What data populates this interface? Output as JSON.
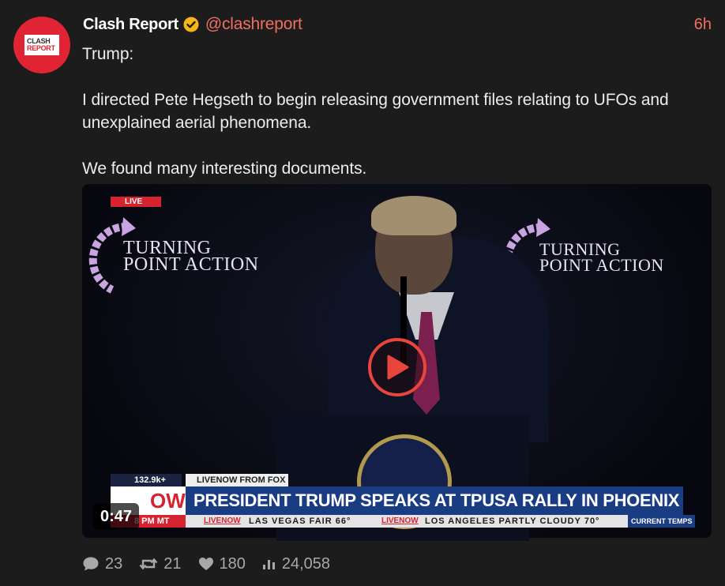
{
  "post": {
    "display_name": "Clash Report",
    "handle": "@clashreport",
    "time": "6h",
    "avatar": {
      "line1": "CLASH",
      "line2": "REPORT",
      "color": "#e02434"
    },
    "verified_icon": "verified-check-icon",
    "text_lines": [
      "Trump:",
      "I directed Pete Hegseth to begin releasing government files relating to UFOs and unexplained aerial phenomena.",
      "We found many interesting documents."
    ]
  },
  "media": {
    "duration": "0:47",
    "play_icon": "play-icon",
    "live_tag": "LIVE",
    "logo_left": {
      "line1": "TURNING",
      "line2": "POINT ACTION"
    },
    "logo_right": {
      "line1": "TURNING",
      "line2": "POINT ACTION"
    },
    "chyron": {
      "views": "132.9k+",
      "source": "LIVENOW FROM FOX",
      "network_logo": "OW",
      "headline": "PRESIDENT TRUMP SPEAKS AT TPUSA RALLY IN PHOENIX",
      "time": "8 PM MT",
      "ticker_logo": "LIVENOW",
      "ticker_1": "LAS VEGAS  FAIR 66°",
      "ticker_2": "LOS ANGELES  PARTLY CLOUDY 70°",
      "ticker_label": "CURRENT TEMPS"
    }
  },
  "actions": {
    "replies": "23",
    "reposts": "21",
    "likes": "180",
    "views": "24,058"
  },
  "colors": {
    "background": "#1c1c1d",
    "accent": "#f0705f",
    "verified": "#f5b417"
  }
}
